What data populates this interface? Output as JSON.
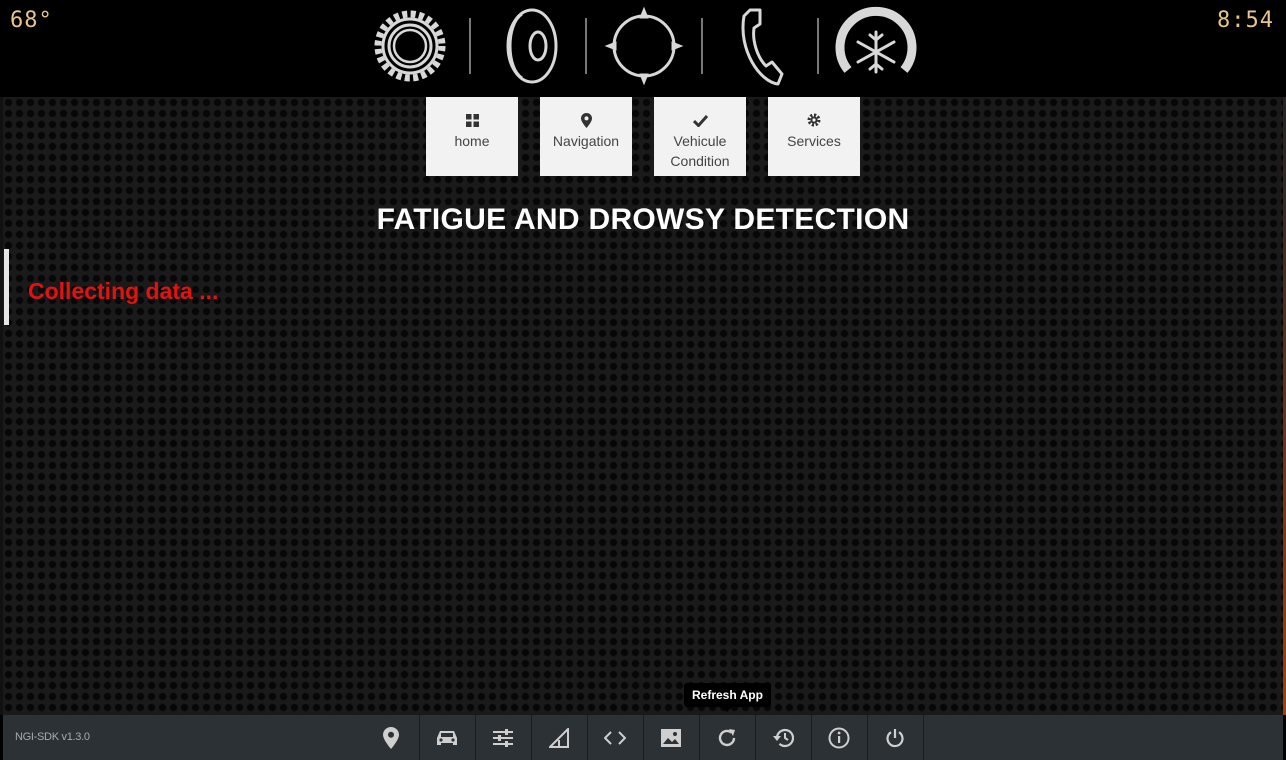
{
  "status_bar": {
    "temperature": "68°",
    "time": "8:54"
  },
  "top_icons": [
    "gear-icon",
    "speaker-icon",
    "compass-icon",
    "phone-icon",
    "climate-snowflake-icon"
  ],
  "nav": {
    "home": "home",
    "navigation": "Navigation",
    "vehicle_line1": "Vehicule",
    "vehicle_line2": "Condition",
    "services": "Services"
  },
  "page": {
    "title": "FATIGUE AND DROWSY DETECTION",
    "status": "Collecting data ..."
  },
  "bottom": {
    "version": "NGI-SDK v1.3.0",
    "tooltip": "Refresh App",
    "icons": [
      "location-icon",
      "car-icon",
      "sliders-icon",
      "signal-icon",
      "code-icon",
      "image-icon",
      "refresh-icon",
      "history-icon",
      "info-icon",
      "power-icon"
    ]
  },
  "colors": {
    "accent_text": "#e8c58a",
    "status_red": "#e3120f",
    "bottom_bar": "#2c3136"
  }
}
